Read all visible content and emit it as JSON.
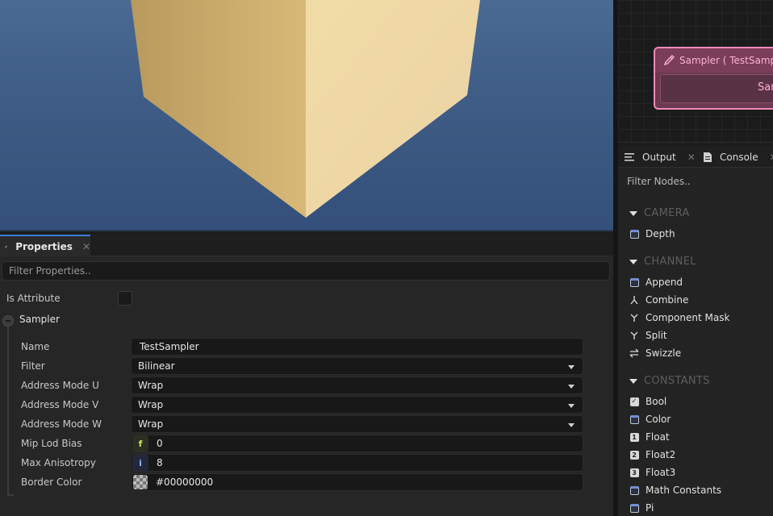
{
  "properties_panel": {
    "tab_label": "Properties",
    "filter_placeholder": "Filter Properties..",
    "is_attribute_label": "Is Attribute",
    "group_label": "Sampler",
    "fields": {
      "name": {
        "label": "Name",
        "value": "TestSampler"
      },
      "filter": {
        "label": "Filter",
        "value": "Bilinear"
      },
      "address_u": {
        "label": "Address Mode U",
        "value": "Wrap"
      },
      "address_v": {
        "label": "Address Mode V",
        "value": "Wrap"
      },
      "address_w": {
        "label": "Address Mode W",
        "value": "Wrap"
      },
      "mip_lod_bias": {
        "label": "Mip Lod Bias",
        "type_badge": "f",
        "value": "0"
      },
      "max_anisotropy": {
        "label": "Max Anisotropy",
        "type_badge": "i",
        "value": "8"
      },
      "border_color": {
        "label": "Border Color",
        "value": "#00000000"
      }
    }
  },
  "graph": {
    "node_title": "Sampler ( TestSampler )",
    "node_body": "Sampler",
    "node_color": "#f08bb8"
  },
  "node_panel": {
    "tabs": {
      "output": "Output",
      "console": "Console"
    },
    "filter_placeholder": "Filter Nodes..",
    "categories": {
      "camera": {
        "title": "CAMERA",
        "items": [
          "Depth"
        ]
      },
      "channel": {
        "title": "CHANNEL",
        "items": [
          "Append",
          "Combine",
          "Component Mask",
          "Split",
          "Swizzle"
        ]
      },
      "constants": {
        "title": "CONSTANTS",
        "items": [
          "Bool",
          "Color",
          "Float",
          "Float2",
          "Float3",
          "Math Constants",
          "Pi"
        ]
      }
    },
    "icons": {
      "depth": "box-icon",
      "append": "box-icon",
      "combine": "merge-icon",
      "component_mask": "fork-icon",
      "split": "fork-icon",
      "swizzle": "swap-icon",
      "bool": "checkbox-icon",
      "color": "box-icon",
      "float": "1",
      "float2": "2",
      "float3": "3",
      "math_constants": "box-icon",
      "pi": "box-icon"
    }
  },
  "colors": {
    "accent": "#3a7bd5",
    "node": "#f08bb8",
    "viewport_bg": "#3f5d86",
    "cube_left": "#c9a86a",
    "cube_right": "#f1dcae"
  }
}
